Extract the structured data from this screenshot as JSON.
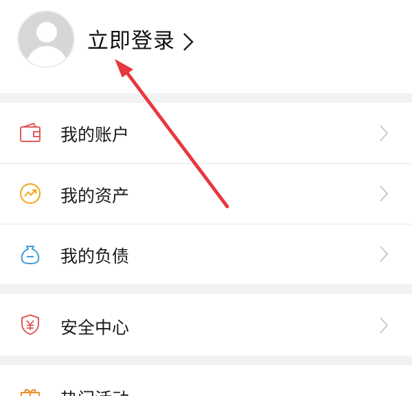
{
  "header": {
    "login_text": "立即登录"
  },
  "menu": {
    "items": [
      {
        "label": "我的账户",
        "icon": "wallet-icon",
        "color": "#e05a5a"
      },
      {
        "label": "我的资产",
        "icon": "trend-up-icon",
        "color": "#f2a51a"
      },
      {
        "label": "我的负债",
        "icon": "money-bag-icon",
        "color": "#3b9bd6"
      },
      {
        "label": "安全中心",
        "icon": "shield-yen-icon",
        "color": "#e05a5a"
      },
      {
        "label": "热门活动",
        "icon": "gift-box-icon",
        "color": "#f28c28"
      }
    ]
  },
  "annotation": {
    "arrow_color": "#e8383d"
  }
}
